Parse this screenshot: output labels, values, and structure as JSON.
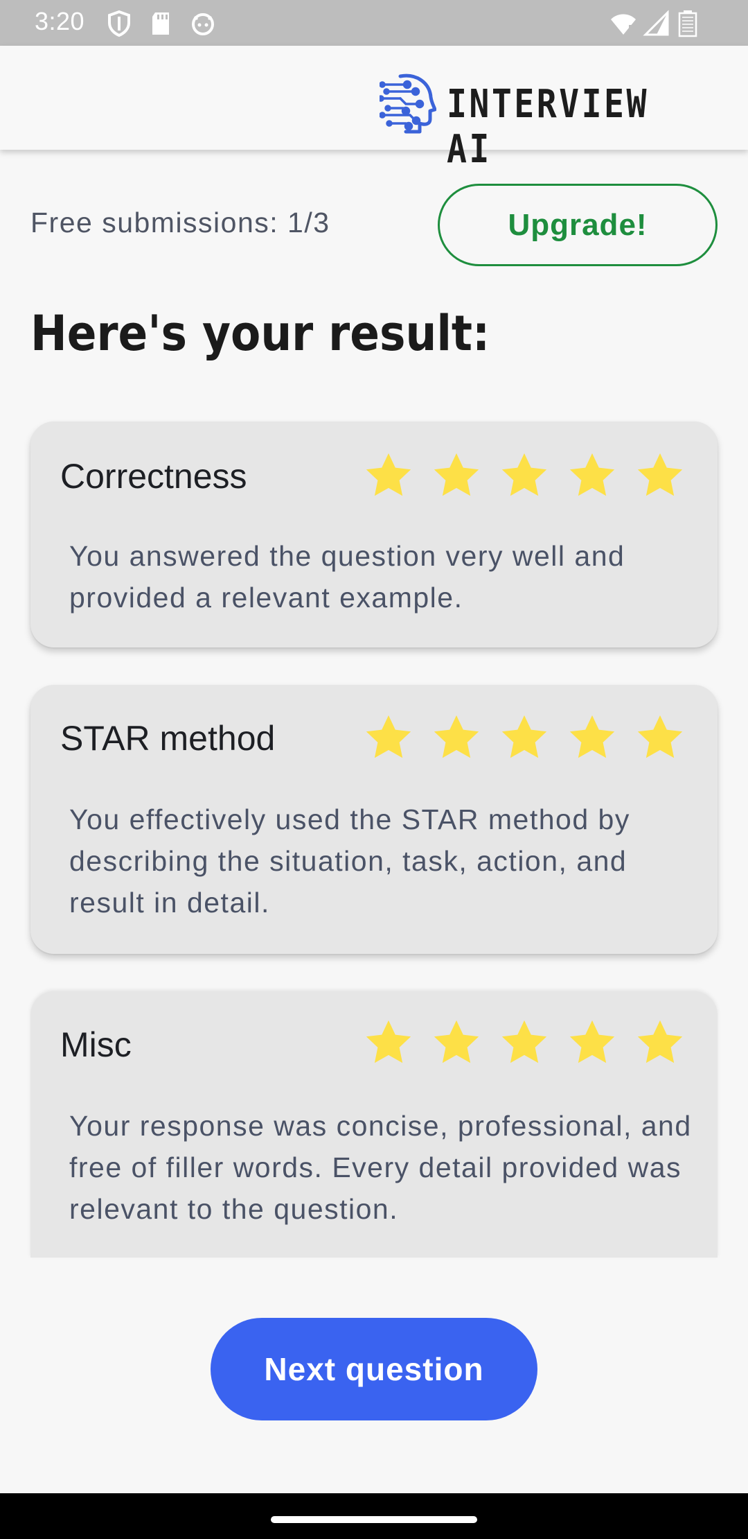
{
  "status_bar": {
    "time": "3:20"
  },
  "header": {
    "app_name": "INTERVIEW AI"
  },
  "submissions": {
    "label": "Free submissions: 1/3",
    "upgrade_label": "Upgrade!"
  },
  "result": {
    "heading": "Here's your result:"
  },
  "cards": [
    {
      "title": "Correctness",
      "rating": 5,
      "max_rating": 5,
      "feedback": "You answered the question very well and provided a relevant example."
    },
    {
      "title": "STAR method",
      "rating": 5,
      "max_rating": 5,
      "feedback": "You effectively used the STAR method by describing the situation, task, action, and result in detail."
    },
    {
      "title": "Misc",
      "rating": 5,
      "max_rating": 5,
      "feedback": "Your response was concise, professional, and free of filler words. Every detail provided was relevant to the question."
    }
  ],
  "actions": {
    "next_label": "Next question"
  },
  "colors": {
    "accent_green": "#1e8e3e",
    "primary_blue": "#3a63f0",
    "star_yellow": "#fde047",
    "logo_blue": "#3b63d9"
  },
  "icons": {
    "status": [
      "shield-icon",
      "sd-card-icon",
      "android-face-icon",
      "wifi-icon",
      "cell-signal-icon",
      "battery-icon"
    ],
    "logo": "ai-head-circuit-icon",
    "rating": "star-icon"
  }
}
